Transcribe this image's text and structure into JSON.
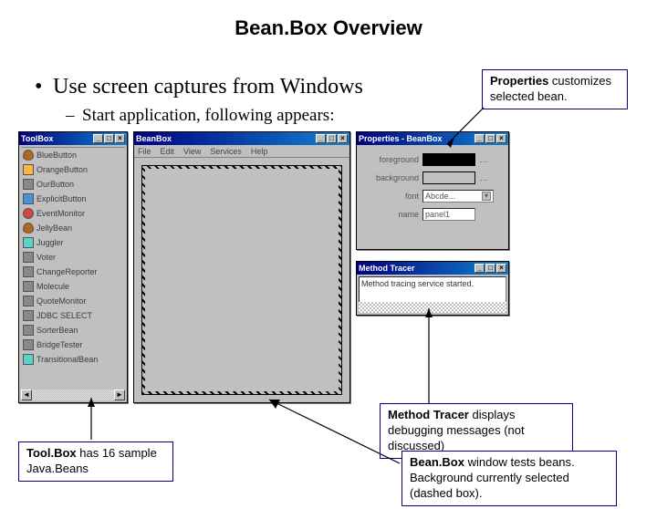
{
  "title": "Bean.Box Overview",
  "bullet_main": "Use screen captures from Windows",
  "bullet_sub": "Start application, following appears:",
  "callouts": {
    "properties": {
      "strong": "Properties",
      "rest": " customizes selected bean."
    },
    "toolbox": {
      "strong": "Tool.Box",
      "rest": " has 16 sample Java.Beans"
    },
    "tracer": {
      "strong": "Method Tracer",
      "rest": " displays debugging messages (not discussed)"
    },
    "beanbox": {
      "strong": "Bean.Box",
      "rest": " window tests beans. Background currently selected (dashed box)."
    }
  },
  "windows": {
    "toolbox": {
      "title": "ToolBox",
      "items": [
        "BlueButton",
        "OrangeButton",
        "OurButton",
        "ExplicitButton",
        "EventMonitor",
        "JellyBean",
        "Juggler",
        "Voter",
        "ChangeReporter",
        "Molecule",
        "QuoteMonitor",
        "JDBC SELECT",
        "SorterBean",
        "BridgeTester",
        "TransitionalBean"
      ]
    },
    "beanbox": {
      "title": "BeanBox",
      "menu": [
        "File",
        "Edit",
        "View",
        "Services",
        "Help"
      ]
    },
    "properties": {
      "title": "Properties - BeanBox",
      "rows": {
        "foreground": "foreground",
        "background": "background",
        "font_label": "font",
        "font_value": "Abcde...",
        "name_label": "name",
        "name_value": "panel1"
      }
    },
    "tracer": {
      "title": "Method Tracer",
      "message": "Method tracing service started."
    }
  }
}
